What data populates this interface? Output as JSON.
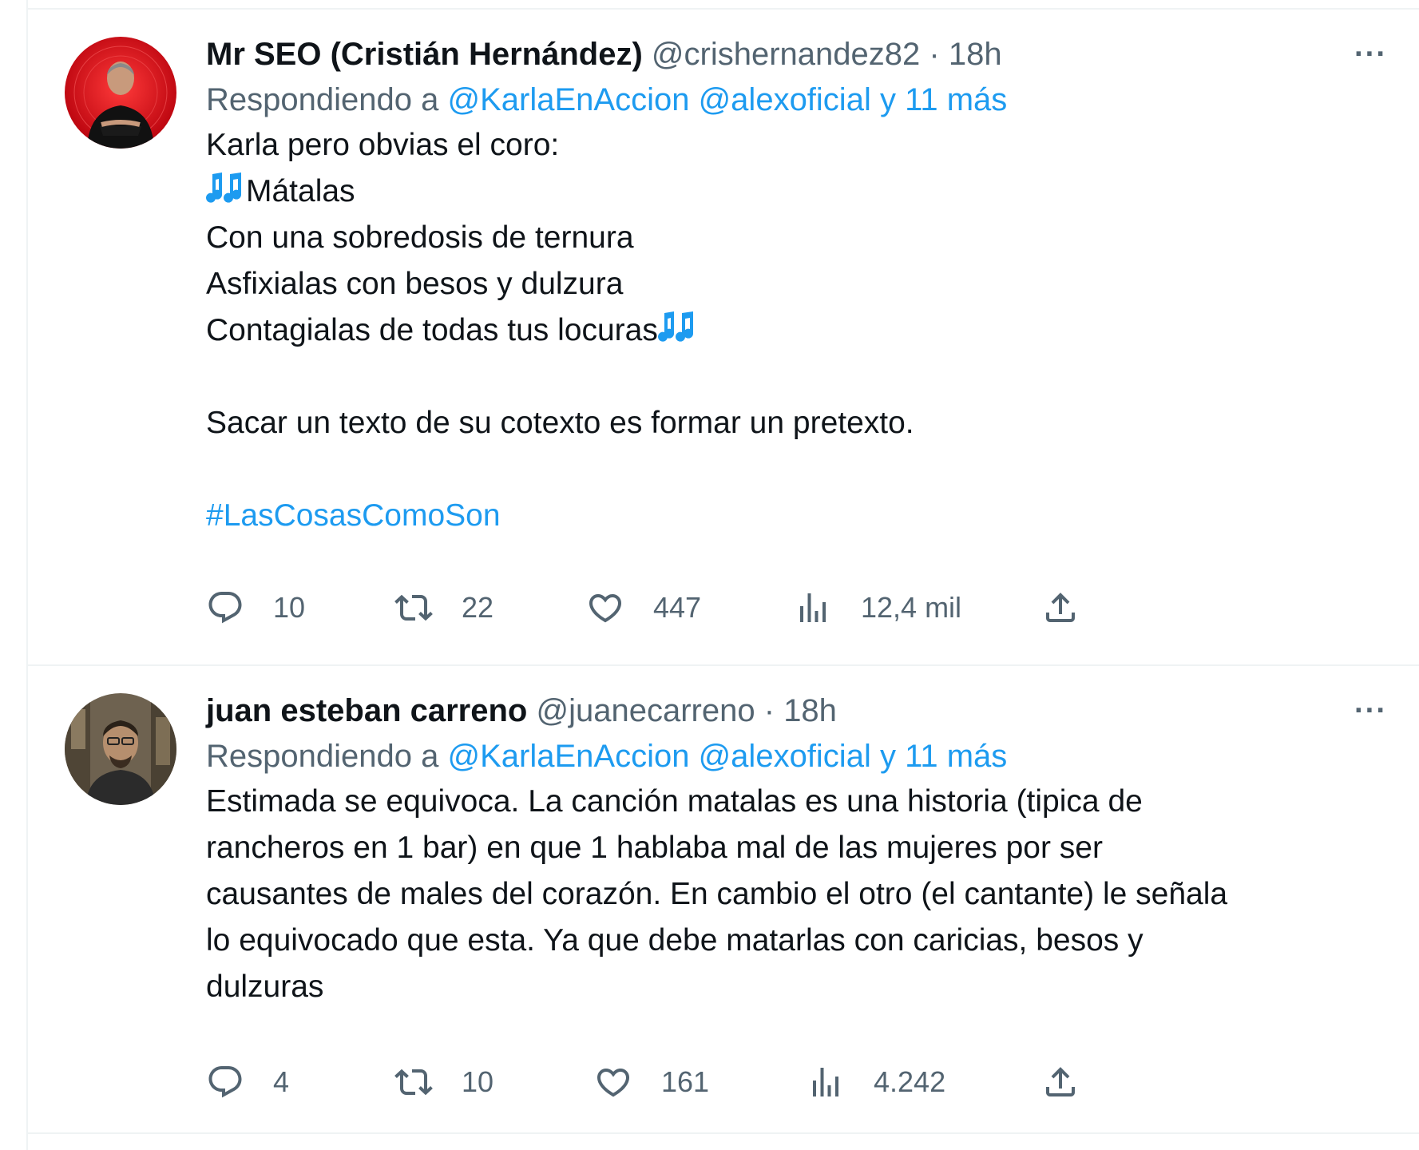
{
  "tweets": [
    {
      "name": "Mr SEO (Cristián Hernández)",
      "handle": "@crishernandez82",
      "separator": "·",
      "time": "18h",
      "more_label": "···",
      "reply_prefix": "Respondiendo a",
      "reply_mentions": [
        "@KarlaEnAccion",
        "@alexoficial"
      ],
      "reply_more": "y 11 más",
      "lines": [
        "Karla pero obvias el coro:",
        "Mátalas",
        "Con una sobredosis de ternura",
        "Asfixialas con besos y dulzura",
        "Contagialas de todas tus locuras",
        "Sacar un texto de su cotexto es formar un pretexto."
      ],
      "hashtag": "#LasCosasComoSon",
      "stats": {
        "replies": "10",
        "retweets": "22",
        "likes": "447",
        "views": "12,4 mil"
      }
    },
    {
      "name": "juan esteban carreno",
      "handle": "@juanecarreno",
      "separator": "·",
      "time": "18h",
      "more_label": "···",
      "reply_prefix": "Respondiendo a",
      "reply_mentions": [
        "@KarlaEnAccion",
        "@alexoficial"
      ],
      "reply_more": "y 11 más",
      "lines": [
        "Estimada se equivoca. La canción matalas es una historia (tipica de",
        "rancheros en 1 bar) en que 1 hablaba mal de las mujeres por ser",
        "causantes de males del corazón. En cambio el otro (el cantante) le señala",
        "lo equivocado que esta. Ya que debe matarlas con caricias, besos y",
        "dulzuras"
      ],
      "stats": {
        "replies": "4",
        "retweets": "10",
        "likes": "161",
        "views": "4.242"
      }
    }
  ],
  "icons": {
    "reply": "reply-icon",
    "retweet": "retweet-icon",
    "like": "heart-icon",
    "views": "views-icon",
    "share": "share-icon",
    "music": "musical-notes-icon"
  },
  "colors": {
    "link": "#1d9bf0",
    "secondary": "#536471",
    "text": "#0f1419",
    "border": "#eff3f4",
    "avatar1_bg": "#e0101c"
  }
}
